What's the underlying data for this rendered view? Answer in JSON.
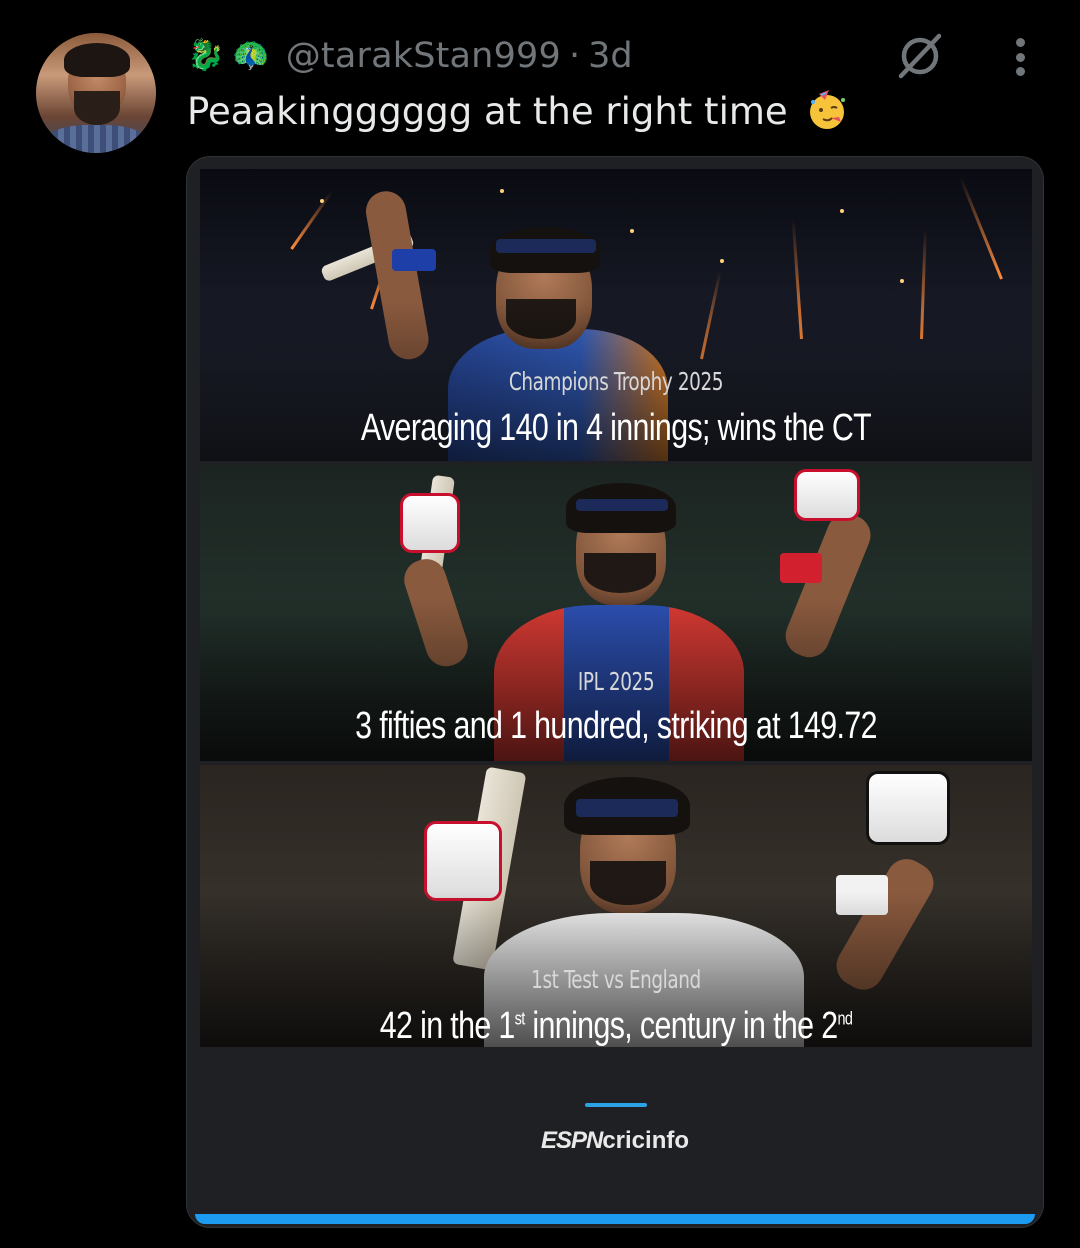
{
  "author": {
    "badges": [
      "🐉",
      "🦚"
    ],
    "handle": "@tarakStan999",
    "separator": "·",
    "time": "3d"
  },
  "tweet": {
    "text": "Peaakingggggg at the right time",
    "emoji": "🥳"
  },
  "icons": {
    "grok": "grok-icon",
    "more": "more-icon"
  },
  "media": {
    "panels": [
      {
        "subtitle": "Champions Trophy 2025",
        "headline": "Averaging 140 in 4 innings; wins the CT"
      },
      {
        "subtitle": "IPL 2025",
        "headline": "3 fifties and 1 hundred, striking at 149.72"
      },
      {
        "subtitle": "1st Test vs England",
        "headline_parts": [
          "42 in the 1",
          "st",
          " innings, century in the 2",
          "nd"
        ]
      }
    ],
    "brand": {
      "espn": "ESPN",
      "rest": "cricinfo"
    },
    "progress_fraction": 1.0
  },
  "colors": {
    "background": "#000000",
    "text": "#e7e9ea",
    "muted": "#71767b",
    "accent": "#1d9bf0"
  }
}
